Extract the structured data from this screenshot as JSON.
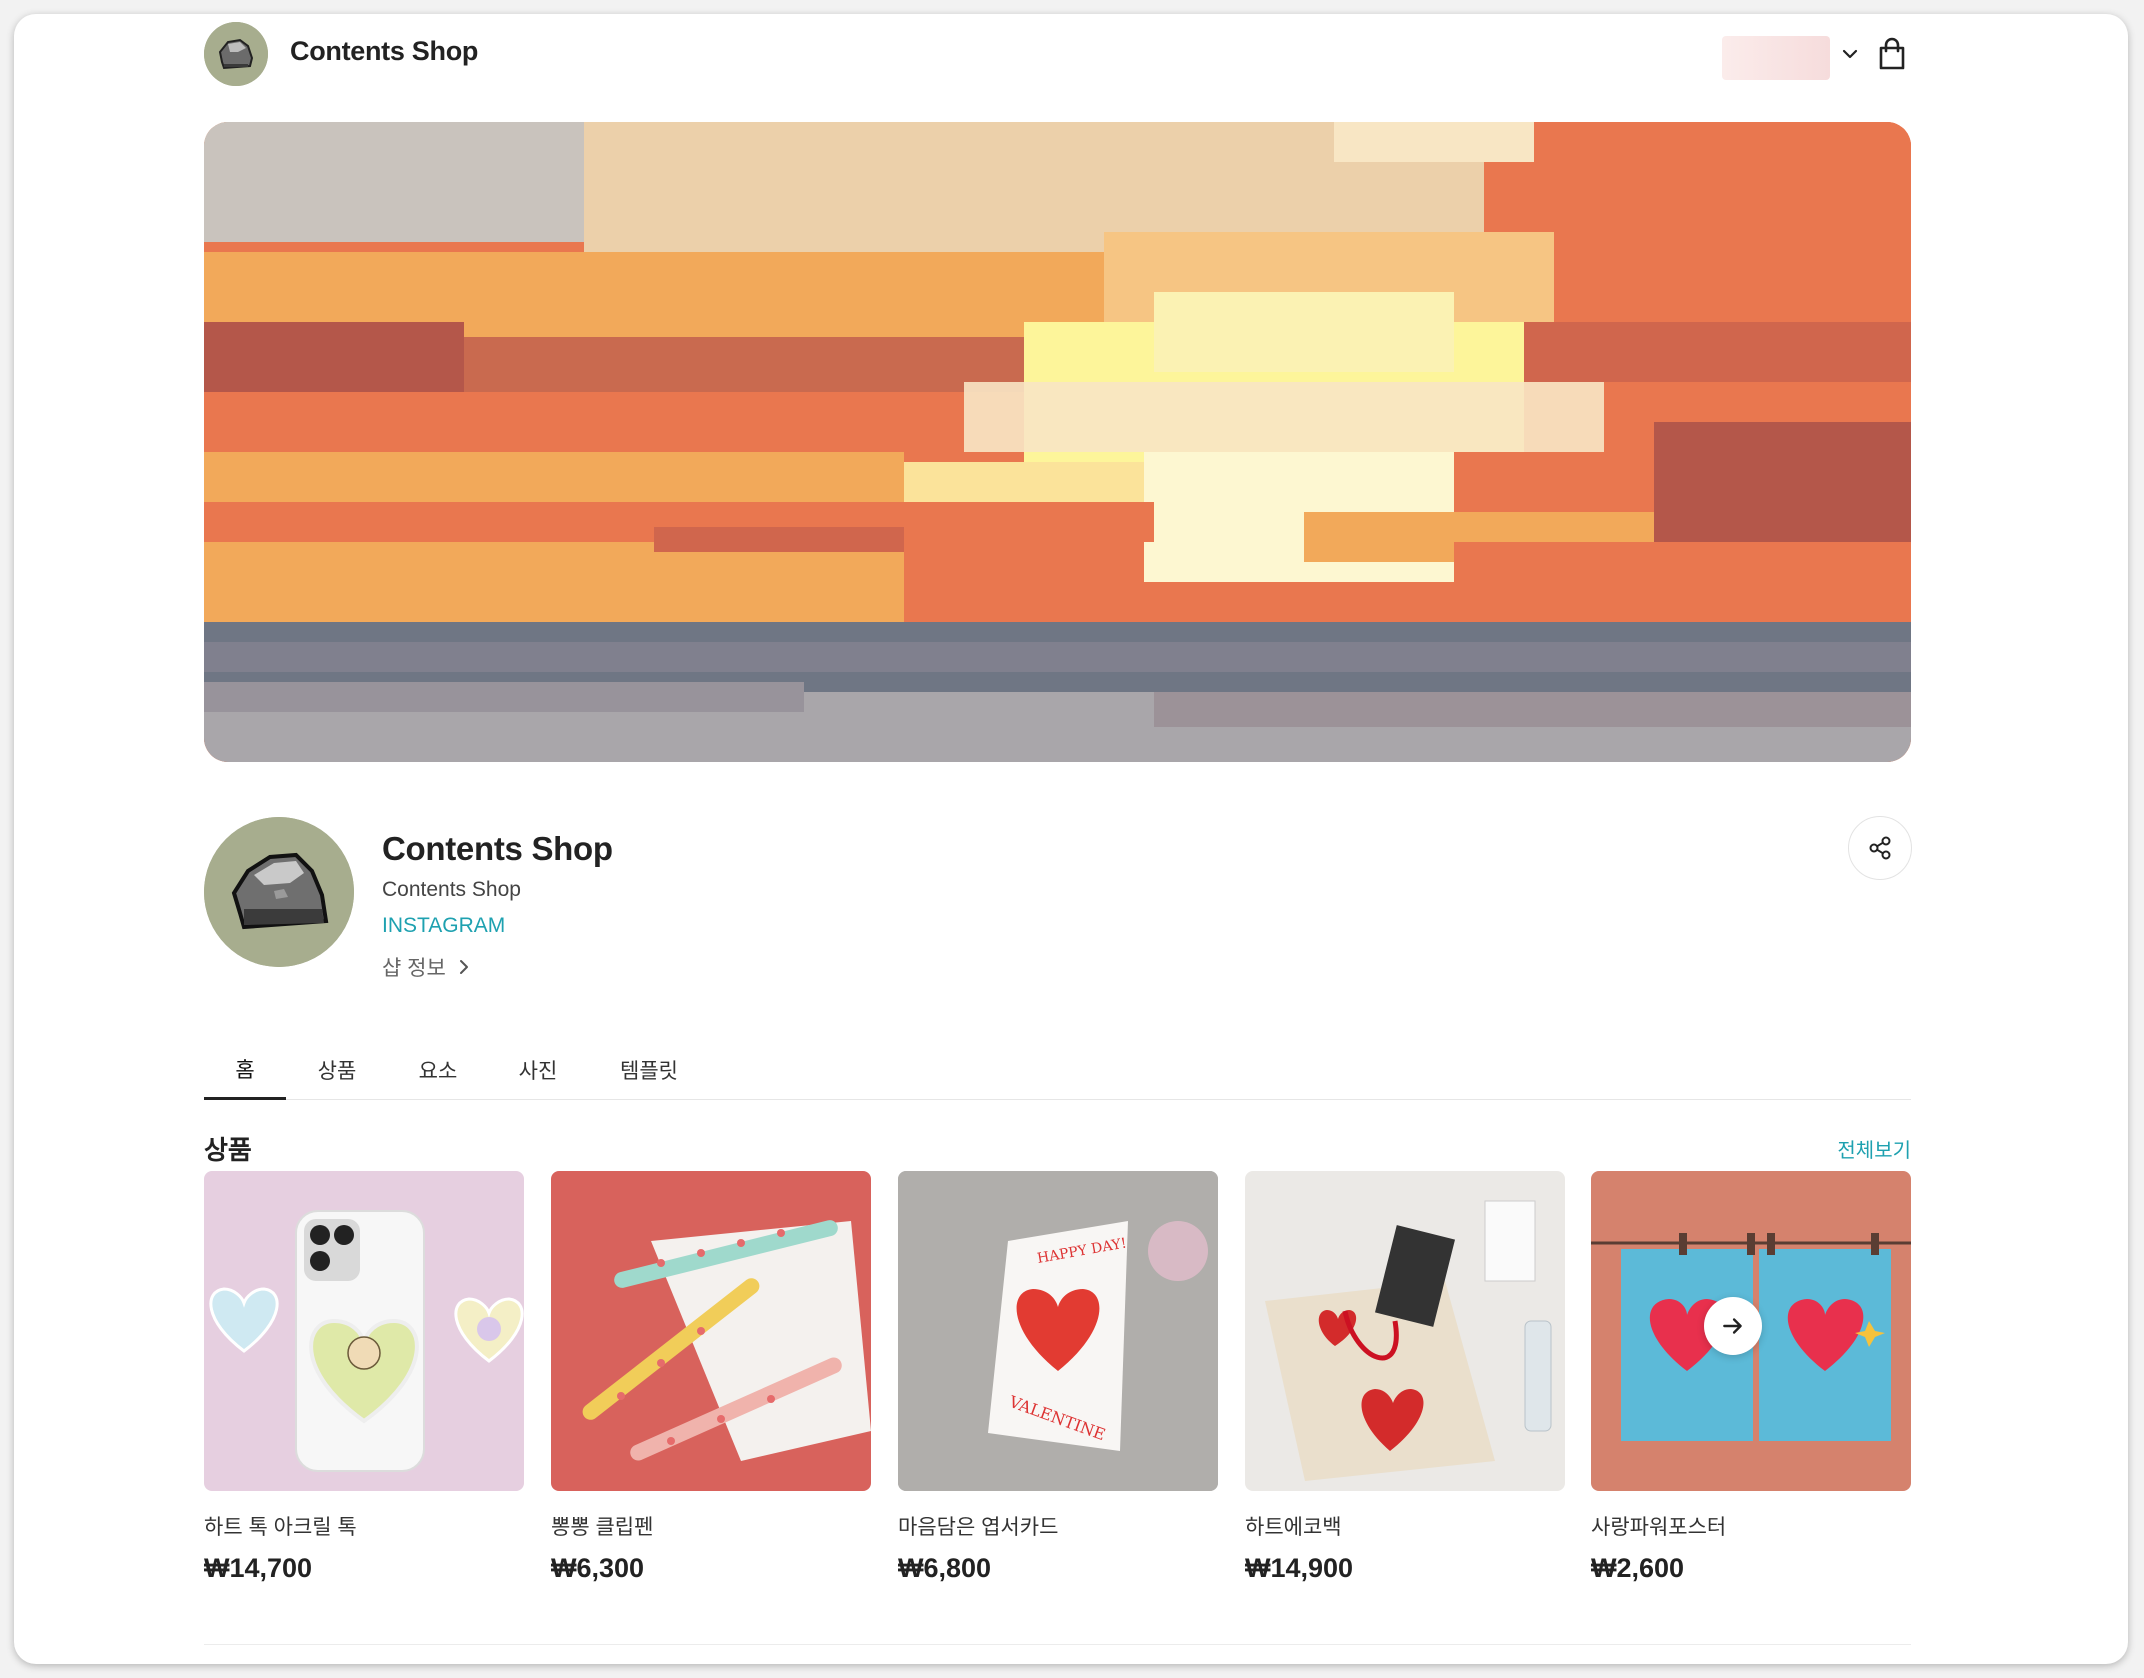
{
  "header": {
    "shop_name": "Contents Shop",
    "logo_icon": "rock-logo-icon",
    "lang_icon": "chevron-down-icon",
    "cart_icon": "shopping-bag-icon"
  },
  "profile": {
    "title": "Contents Shop",
    "subtitle": "Contents Shop",
    "instagram": "INSTAGRAM",
    "shop_info": "샵 정보",
    "share_icon": "share-icon"
  },
  "tabs": [
    {
      "label": "홈",
      "active": true
    },
    {
      "label": "상품"
    },
    {
      "label": "요소"
    },
    {
      "label": "사진"
    },
    {
      "label": "템플릿"
    }
  ],
  "section": {
    "title": "상품",
    "view_all": "전체보기"
  },
  "products": [
    {
      "name": "하트 톡 아크릴 톡",
      "price": "₩14,700"
    },
    {
      "name": "뽕뽕 클립펜",
      "price": "₩6,300"
    },
    {
      "name": "마음담은 엽서카드",
      "price": "₩6,800",
      "card_text_top": "HAPPY DAY!",
      "card_text_bottom": "VALENTINE"
    },
    {
      "name": "하트에코백",
      "price": "₩14,900"
    },
    {
      "name": "사랑파워포스터",
      "price": "₩2,600"
    }
  ],
  "colors": {
    "accent": "#1ea1b0",
    "logo_bg": "#a7ad8e",
    "banner_sky": "#e9774f",
    "banner_sun": "#fdf59a"
  }
}
